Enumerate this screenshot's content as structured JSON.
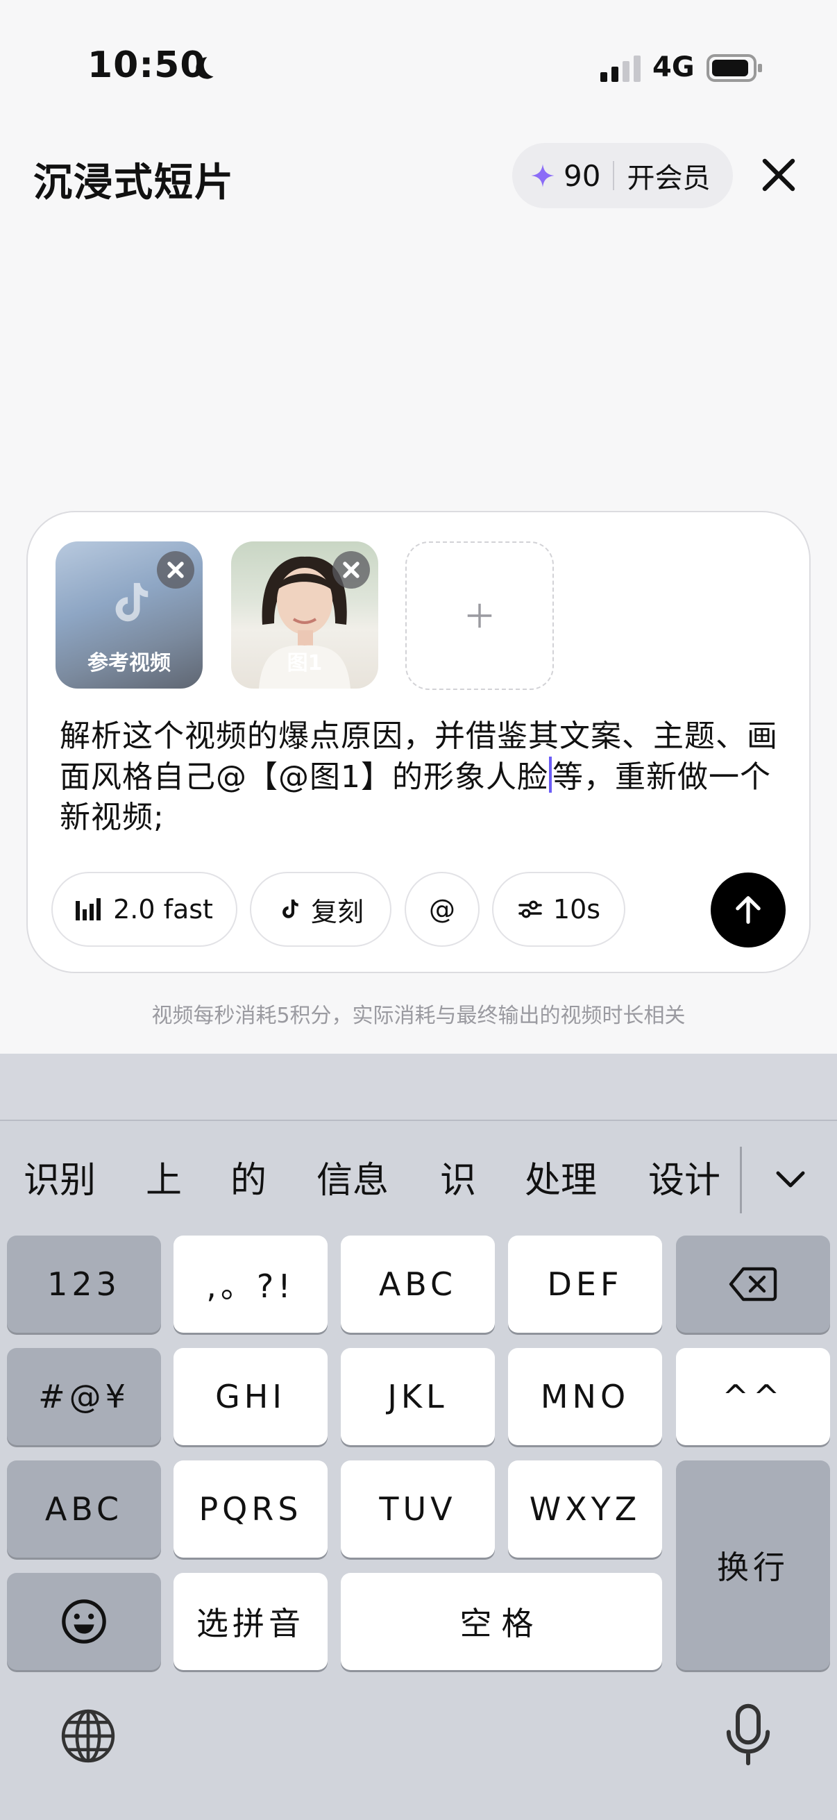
{
  "status_bar": {
    "time": "10:50",
    "network": "4G"
  },
  "header": {
    "title": "沉浸式短片",
    "credits": "90",
    "vip_label": "开会员"
  },
  "attachments": [
    {
      "label": "参考视频"
    },
    {
      "label": "图1"
    }
  ],
  "prompt": {
    "text_before_caret": "解析这个视频的爆点原因，并借鉴其文案、主题、画面风格自己@【@图1】的形象人脸",
    "text_after_caret": "等，重新做一个新视频;"
  },
  "toolbar": {
    "model_label": "2.0 fast",
    "remix_label": "复刻",
    "mention_label": "@",
    "duration_label": "10s"
  },
  "hint": "视频每秒消耗5积分，实际消耗与最终输出的视频时长相关",
  "keyboard": {
    "candidates": [
      "识别",
      "上",
      "的",
      "信息",
      "识",
      "处理",
      "设计"
    ],
    "rows": [
      [
        "123",
        ",。?!",
        "ABC",
        "DEF"
      ],
      [
        "#@¥",
        "GHI",
        "JKL",
        "MNO",
        "^^"
      ],
      [
        "ABC",
        "PQRS",
        "TUV",
        "WXYZ",
        "换行"
      ],
      [
        "选拼音",
        "空格"
      ]
    ]
  },
  "colors": {
    "accent": "#6b5cf6",
    "send_button": "#000000",
    "keyboard_bg": "#d1d4db"
  }
}
